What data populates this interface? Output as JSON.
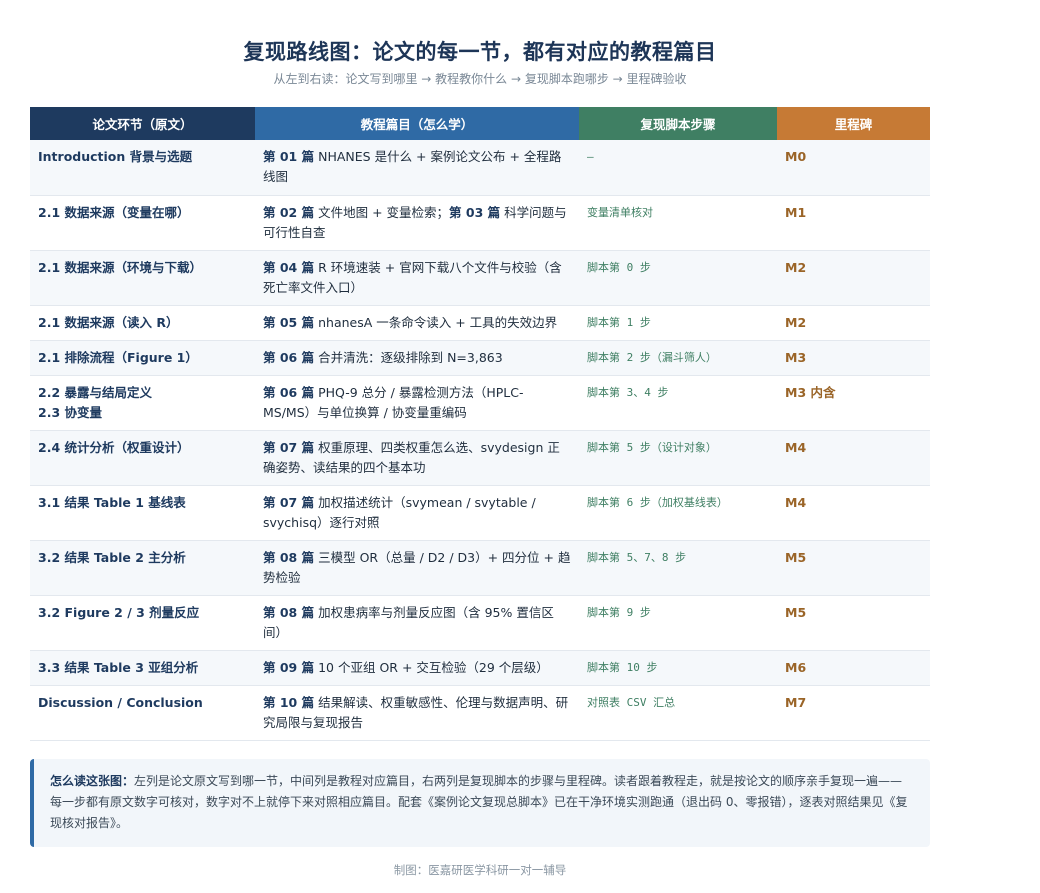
{
  "title": "复现路线图：论文的每一节，都有对应的教程篇目",
  "subtitle": "从左到右读：论文写到哪里 → 教程教你什么 → 复现脚本跑哪步 → 里程碑验收",
  "headers": [
    "论文环节（原文）",
    "教程篇目（怎么学）",
    "复现脚本步骤",
    "里程碑"
  ],
  "rows": [
    {
      "section": "Introduction 背景与选题",
      "parts": [
        {
          "tag": "第 01 篇",
          "text": "NHANES 是什么 + 案例论文公布 + 全程路线图"
        }
      ],
      "step": "—",
      "milestone": "M0"
    },
    {
      "section": "2.1 数据来源（变量在哪）",
      "parts": [
        {
          "tag": "第 02 篇",
          "text": "文件地图 + 变量检索；"
        },
        {
          "tag": "第 03 篇",
          "text": "科学问题与可行性自查"
        }
      ],
      "step": "变量清单核对",
      "milestone": "M1"
    },
    {
      "section": "2.1 数据来源（环境与下载）",
      "parts": [
        {
          "tag": "第 04 篇",
          "text": "R 环境速装 + 官网下载八个文件与校验（含死亡率文件入口）"
        }
      ],
      "step": "脚本第 0 步",
      "milestone": "M2"
    },
    {
      "section": "2.1 数据来源（读入 R）",
      "parts": [
        {
          "tag": "第 05 篇",
          "text": "nhanesA 一条命令读入 + 工具的失效边界"
        }
      ],
      "step": "脚本第 1 步",
      "milestone": "M2"
    },
    {
      "section": "2.1 排除流程（Figure 1）",
      "parts": [
        {
          "tag": "第 06 篇",
          "text": "合并清洗：逐级排除到 N=3,863"
        }
      ],
      "step": "脚本第 2 步（漏斗筛人）",
      "milestone": "M3"
    },
    {
      "section": "2.2 暴露与结局定义\n2.3 协变量",
      "parts": [
        {
          "tag": "第 06 篇",
          "text": "PHQ-9 总分 / 暴露检测方法（HPLC-MS/MS）与单位换算 / 协变量重编码"
        }
      ],
      "step": "脚本第 3、4 步",
      "milestone": "M3 内含"
    },
    {
      "section": "2.4 统计分析（权重设计）",
      "parts": [
        {
          "tag": "第 07 篇",
          "text": "权重原理、四类权重怎么选、svydesign 正确姿势、读结果的四个基本功"
        }
      ],
      "step": "脚本第 5 步（设计对象）",
      "milestone": "M4"
    },
    {
      "section": "3.1 结果 Table 1 基线表",
      "parts": [
        {
          "tag": "第 07 篇",
          "text": "加权描述统计（svymean / svytable / svychisq）逐行对照"
        }
      ],
      "step": "脚本第 6 步（加权基线表）",
      "milestone": "M4"
    },
    {
      "section": "3.2 结果 Table 2 主分析",
      "parts": [
        {
          "tag": "第 08 篇",
          "text": "三模型 OR（总量 / D2 / D3）+ 四分位 + 趋势检验"
        }
      ],
      "step": "脚本第 5、7、8 步",
      "milestone": "M5"
    },
    {
      "section": "3.2 Figure 2 / 3 剂量反应",
      "parts": [
        {
          "tag": "第 08 篇",
          "text": "加权患病率与剂量反应图（含 95% 置信区间）"
        }
      ],
      "step": "脚本第 9 步",
      "milestone": "M5"
    },
    {
      "section": "3.3 结果 Table 3 亚组分析",
      "parts": [
        {
          "tag": "第 09 篇",
          "text": "10 个亚组 OR + 交互检验（29 个层级）"
        }
      ],
      "step": "脚本第 10 步",
      "milestone": "M6"
    },
    {
      "section": "Discussion / Conclusion",
      "parts": [
        {
          "tag": "第 10 篇",
          "text": "结果解读、权重敏感性、伦理与数据声明、研究局限与复现报告"
        }
      ],
      "step": "对照表 CSV 汇总",
      "milestone": "M7"
    }
  ],
  "note": {
    "label": "怎么读这张图：",
    "text": "左列是论文原文写到哪一节，中间列是教程对应篇目，右两列是复现脚本的步骤与里程碑。读者跟着教程走，就是按论文的顺序亲手复现一遍——每一步都有原文数字可核对，数字对不上就停下来对照相应篇目。配套《案例论文复现总脚本》已在干净环境实测跑通（退出码 0、零报错），逐表对照结果见《复现核对报告》。"
  },
  "footer": "制图：医嘉研医学科研一对一辅导",
  "colors": {
    "header_1": "#1e3a5f",
    "header_2": "#2f6aa5",
    "header_3": "#3f7f63",
    "header_4": "#c67a35",
    "milestone": "#9a6427"
  }
}
